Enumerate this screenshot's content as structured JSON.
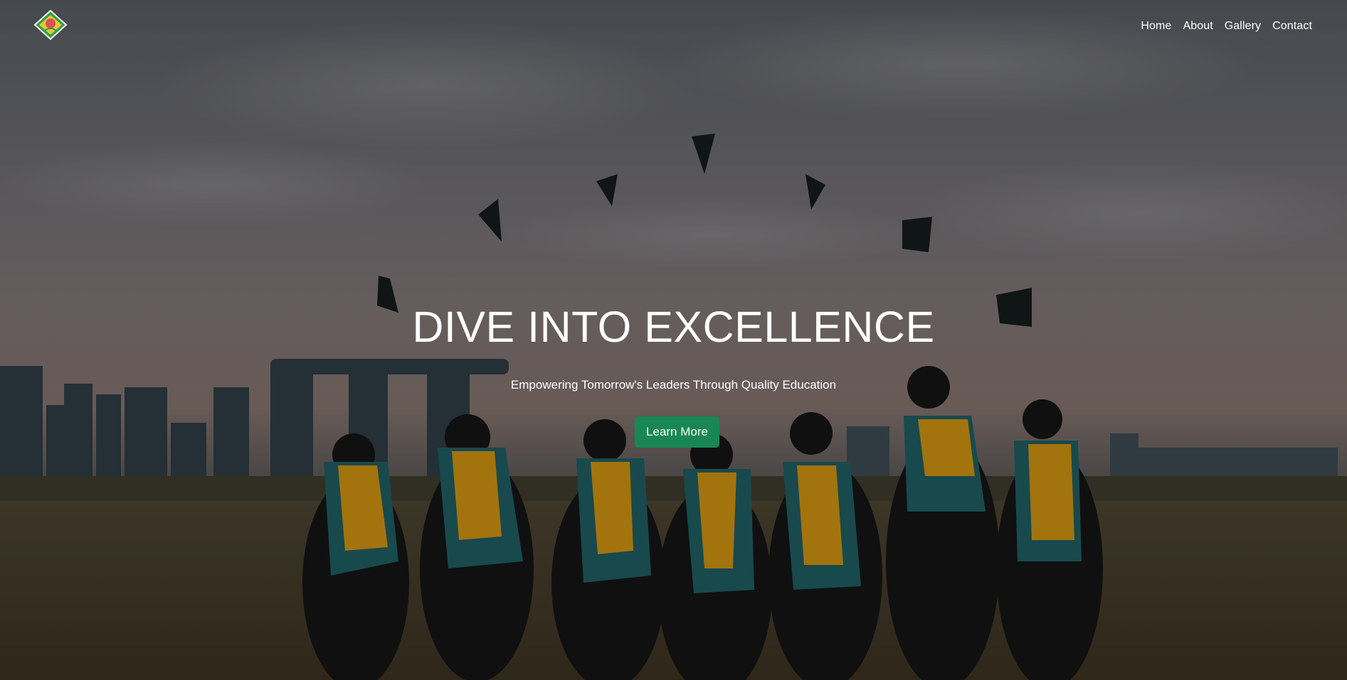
{
  "nav": {
    "logo_alt": "school-crest-logo",
    "links": [
      "Home",
      "About",
      "Gallery",
      "Contact"
    ]
  },
  "hero": {
    "title": "DIVE INTO EXCELLENCE",
    "subtitle": "Empowering Tomorrow's Leaders Through Quality Education",
    "cta_label": "Learn More"
  },
  "colors": {
    "accent": "#198754",
    "text": "#ffffff"
  },
  "background_image": "graduates-throwing-caps-city-skyline"
}
